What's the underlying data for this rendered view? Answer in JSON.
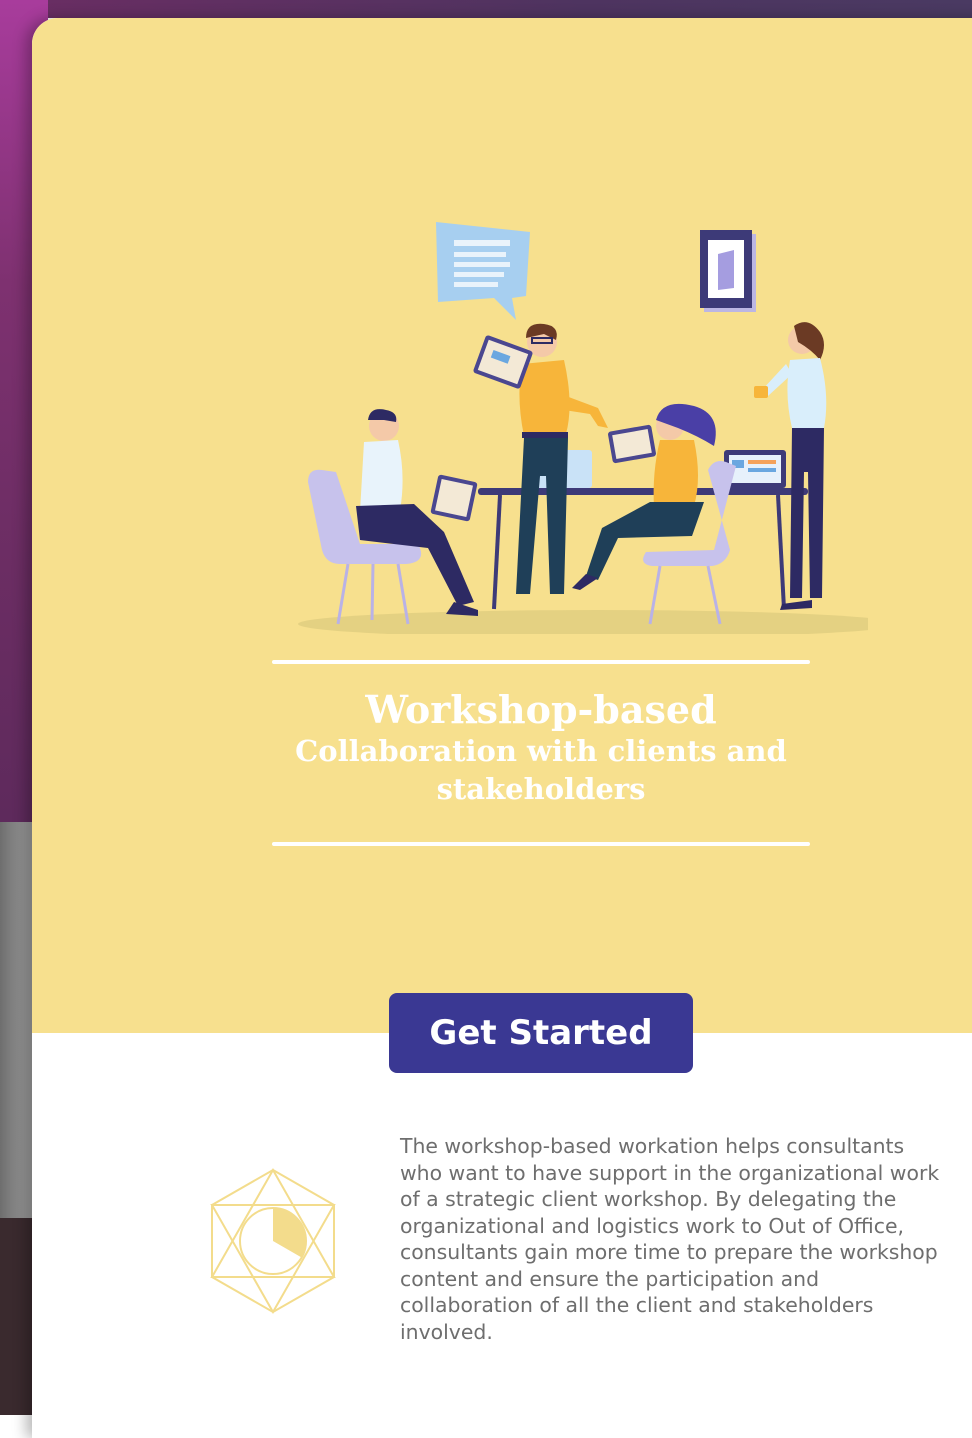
{
  "hero": {
    "title_line1": "Workshop-based",
    "title_line2": "Collaboration with clients and stakeholders"
  },
  "cta": {
    "label": "Get Started"
  },
  "description": "The workshop-based workation helps consultants who want to have support in the organizational work of a strategic client workshop. By delegating the organizational and logistics work to Out of Office, consultants gain more time to prepare the workshop content and ensure the participation and collaboration of all the client and stakeholders involved.",
  "colors": {
    "hero_background": "#f7e08e",
    "button": "#3a3893",
    "description_text": "#6e6e6e",
    "emblem": "#f3dc8c"
  },
  "icons": {
    "illustration": "team-meeting-illustration",
    "emblem": "hexagon-pie-emblem-icon"
  }
}
